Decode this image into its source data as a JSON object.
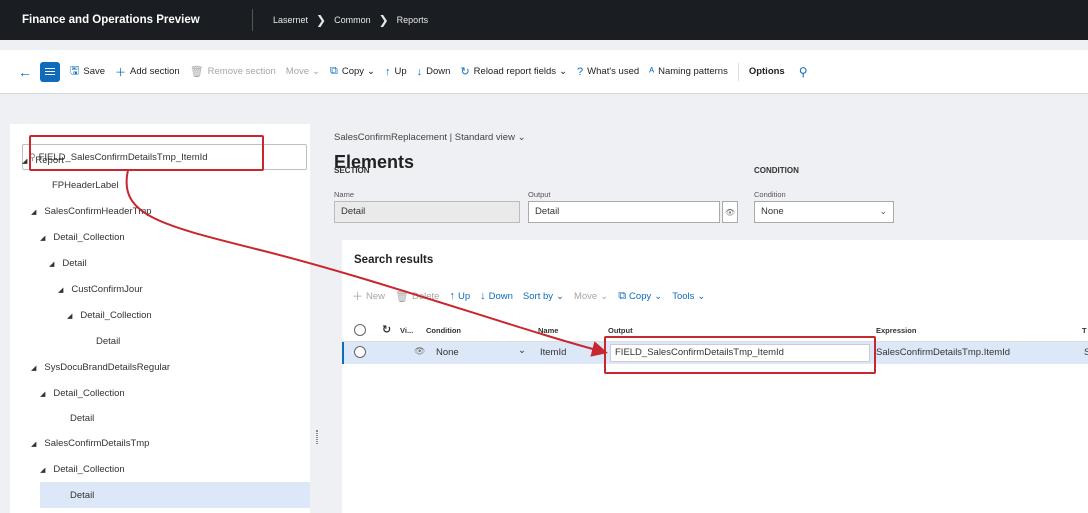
{
  "appbar": {
    "title": "Finance and Operations Preview",
    "breadcrumb": [
      "Lasernet",
      "Common",
      "Reports"
    ]
  },
  "actionbar": {
    "save": "Save",
    "add_section": "Add section",
    "remove_section": "Remove section",
    "move": "Move",
    "copy": "Copy",
    "up": "Up",
    "down": "Down",
    "reload": "Reload report fields",
    "whats_used": "What's used",
    "naming_patterns": "Naming patterns",
    "options": "Options"
  },
  "tree": {
    "search_value": "FIELD_SalesConfirmDetailsTmp_ItemId",
    "items": [
      {
        "label": "Report"
      },
      {
        "label": "FPHeaderLabel"
      },
      {
        "label": "SalesConfirmHeaderTmp"
      },
      {
        "label": "Detail_Collection"
      },
      {
        "label": "Detail"
      },
      {
        "label": "CustConfirmJour"
      },
      {
        "label": "Detail_Collection"
      },
      {
        "label": "Detail"
      },
      {
        "label": "SysDocuBrandDetailsRegular"
      },
      {
        "label": "Detail_Collection"
      },
      {
        "label": "Detail"
      },
      {
        "label": "SalesConfirmDetailsTmp"
      },
      {
        "label": "Detail_Collection"
      },
      {
        "label": "Detail"
      }
    ]
  },
  "main": {
    "view_line": "SalesConfirmReplacement  |  Standard view",
    "heading": "Elements",
    "section_label": "SECTION",
    "condition_label": "CONDITION",
    "name_label": "Name",
    "name_value": "Detail",
    "output_label": "Output",
    "output_value": "Detail",
    "condition_field_label": "Condition",
    "condition_value": "None"
  },
  "results": {
    "title": "Search results",
    "toolbar": {
      "new": "New",
      "delete": "Delete",
      "up": "Up",
      "down": "Down",
      "sort_by": "Sort by",
      "move": "Move",
      "copy": "Copy",
      "tools": "Tools"
    },
    "columns": {
      "vi": "Vi...",
      "condition": "Condition",
      "name": "Name",
      "output": "Output",
      "expression": "Expression",
      "trailing": "T"
    },
    "row": {
      "condition": "None",
      "name": "ItemId",
      "output": "FIELD_SalesConfirmDetailsTmp_ItemId",
      "expression": "SalesConfirmDetailsTmp.ItemId",
      "trailing": "S"
    }
  },
  "colors": {
    "accent": "#0f6cbd",
    "callout": "#c8272f",
    "appbar": "#1a1d21",
    "selected_row": "#dce8f7"
  }
}
